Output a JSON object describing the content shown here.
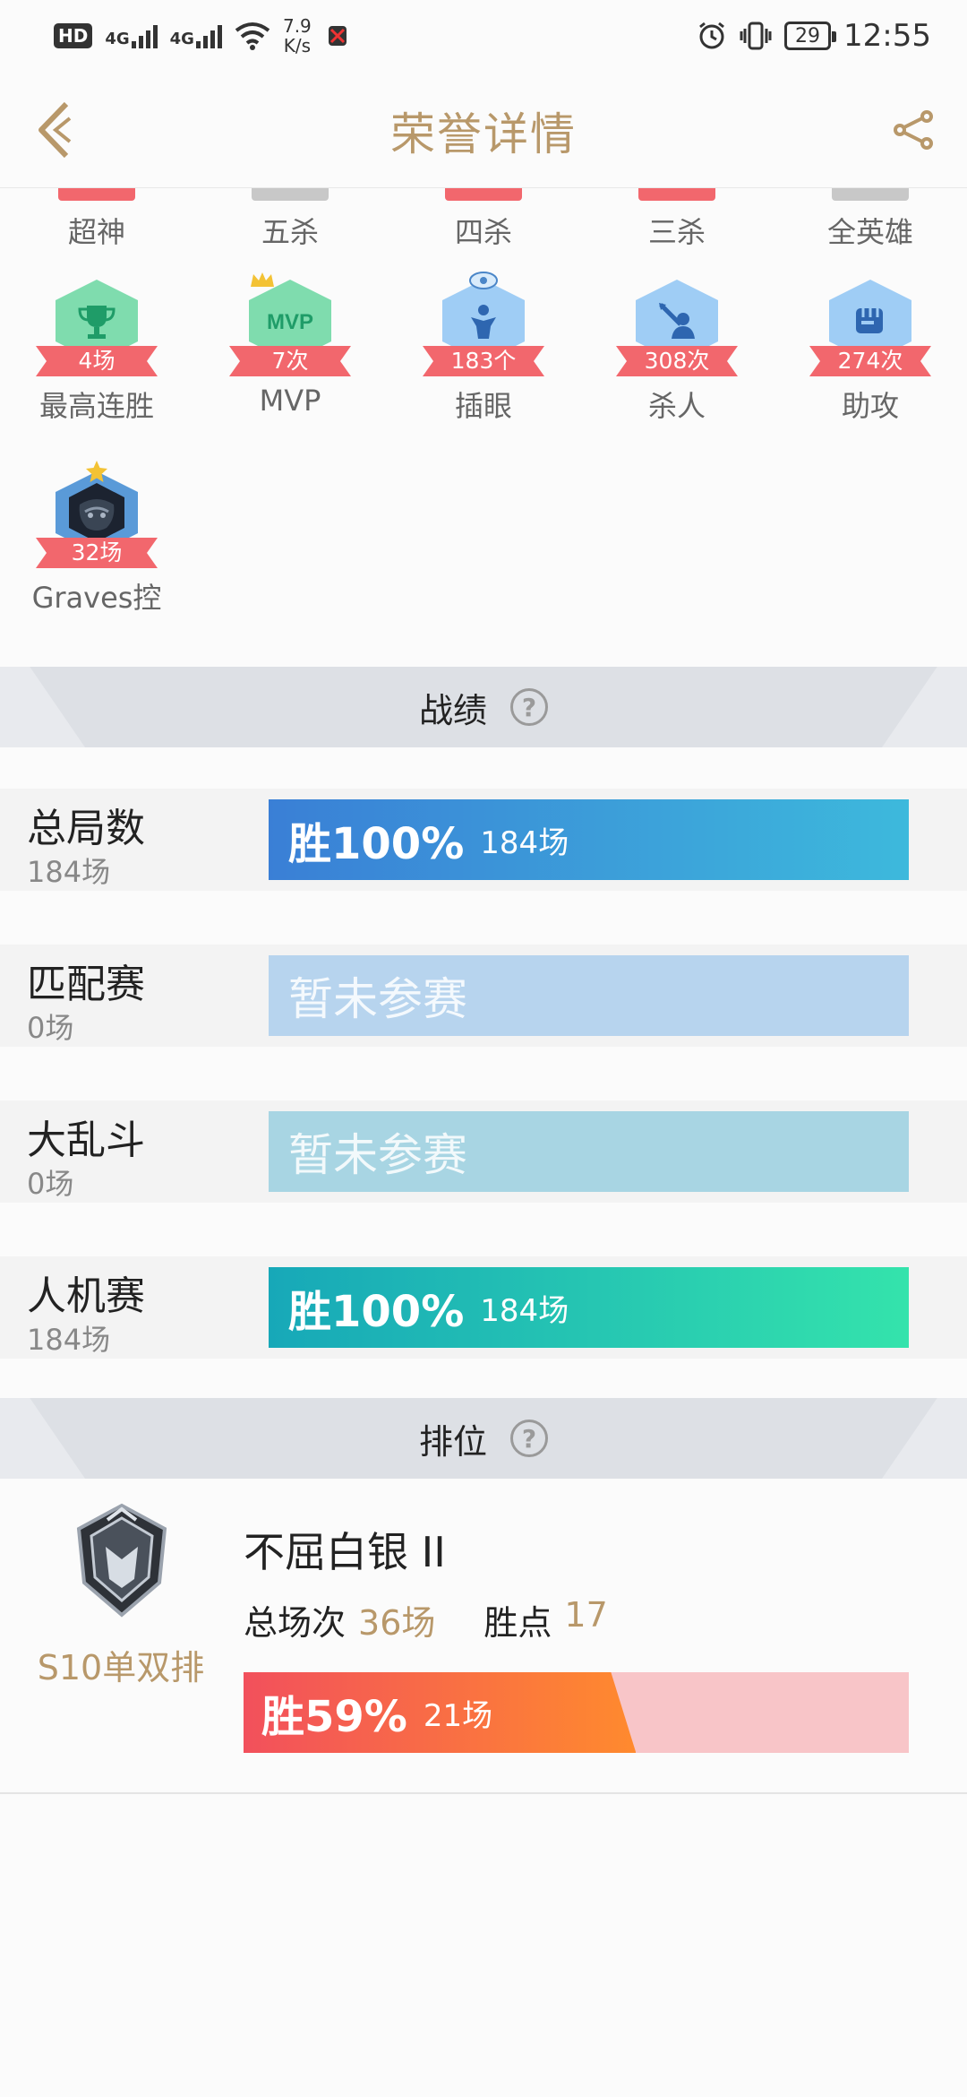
{
  "status_bar": {
    "hd": "HD",
    "sim2": "2",
    "net1": "4G",
    "net2": "4G",
    "speed_value": "7.9",
    "speed_unit": "K/s",
    "battery": "29",
    "time": "12:55"
  },
  "header": {
    "title": "荣誉详情"
  },
  "badges_top_row": [
    {
      "label": "超神",
      "ribbon_color": "#f2676d"
    },
    {
      "label": "五杀",
      "ribbon_color": "#c8c8c8"
    },
    {
      "label": "四杀",
      "ribbon_color": "#f2676d"
    },
    {
      "label": "三杀",
      "ribbon_color": "#f2676d"
    },
    {
      "label": "全英雄",
      "ribbon_color": "#c8c8c8"
    }
  ],
  "badges": [
    {
      "value": "4场",
      "label": "最高连胜",
      "icon": "trophy-icon",
      "color": "#7fdcae"
    },
    {
      "value": "7次",
      "label": "MVP",
      "icon": "mvp-icon",
      "color": "#7fdcae"
    },
    {
      "value": "183个",
      "label": "插眼",
      "icon": "ward-icon",
      "color": "#9fcdf5"
    },
    {
      "value": "308次",
      "label": "杀人",
      "icon": "kill-icon",
      "color": "#9fcdf5"
    },
    {
      "value": "274次",
      "label": "助攻",
      "icon": "assist-fist-icon",
      "color": "#9fcdf5"
    },
    {
      "value": "32场",
      "label": "Graves控",
      "icon": "graves-champion-icon",
      "color": "#5a9ad8"
    }
  ],
  "record_section": {
    "title": "战绩"
  },
  "stats": [
    {
      "name": "总局数",
      "count": "184场",
      "win_label": "胜100%",
      "games": "184场",
      "empty_text": "",
      "win_rate": 1.0,
      "color_from": "#3a7fd6",
      "color_to": "#3db9dc"
    },
    {
      "name": "匹配赛",
      "count": "0场",
      "win_label": "",
      "games": "",
      "empty_text": "暂未参赛",
      "win_rate": 0,
      "color_from": "#b7d4ee",
      "color_to": "#b7d4ee"
    },
    {
      "name": "大乱斗",
      "count": "0场",
      "win_label": "",
      "games": "",
      "empty_text": "暂未参赛",
      "win_rate": 0,
      "color_from": "#a8d5e3",
      "color_to": "#a8d5e3"
    },
    {
      "name": "人机赛",
      "count": "184场",
      "win_label": "胜100%",
      "games": "184场",
      "empty_text": "",
      "win_rate": 1.0,
      "color_from": "#17a8b8",
      "color_to": "#34e3ac"
    }
  ],
  "rank_section": {
    "title": "排位"
  },
  "rank": {
    "tier": "不屈白银 II",
    "season": "S10单双排",
    "total_label": "总场次",
    "total_value": "36场",
    "points_label": "胜点",
    "points_value": "17",
    "win_label": "胜59%",
    "win_games": "21场",
    "win_rate": 0.59
  }
}
